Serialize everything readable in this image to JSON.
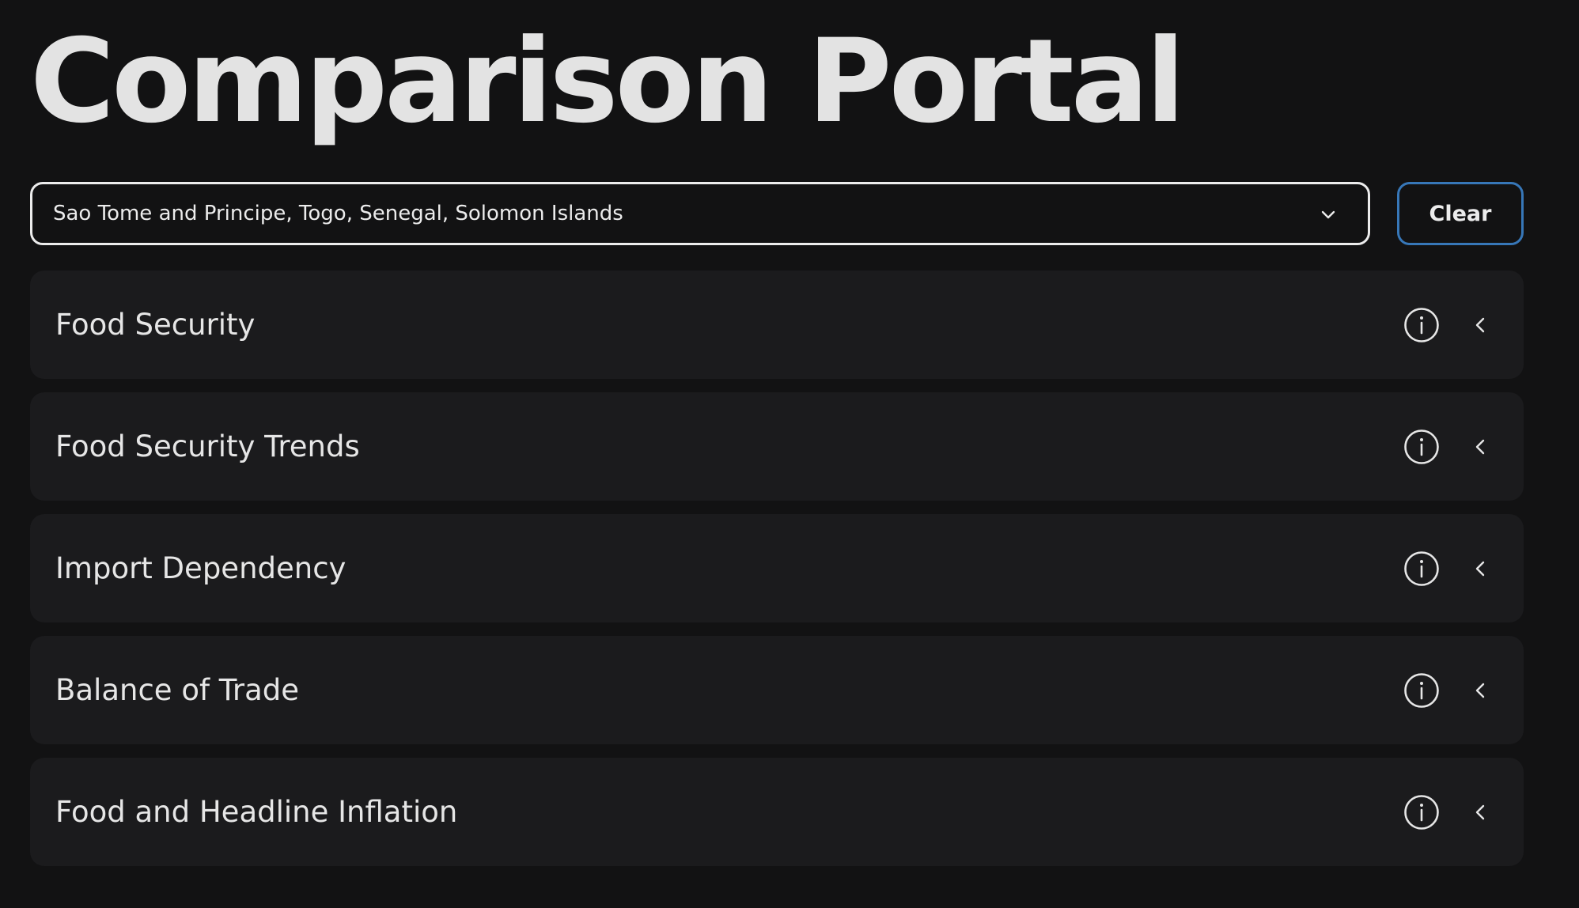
{
  "header": {
    "title": "Comparison Portal"
  },
  "country_select": {
    "value": "Sao Tome and Principe, Togo, Senegal, Solomon Islands",
    "icon": "chevron-down-icon"
  },
  "clear_button": {
    "label": "Clear"
  },
  "accordion": {
    "items": [
      {
        "label": "Food Security",
        "info_icon": "info-icon",
        "toggle_icon": "chevron-left-icon"
      },
      {
        "label": "Food Security Trends",
        "info_icon": "info-icon",
        "toggle_icon": "chevron-left-icon"
      },
      {
        "label": "Import Dependency",
        "info_icon": "info-icon",
        "toggle_icon": "chevron-left-icon"
      },
      {
        "label": "Balance of Trade",
        "info_icon": "info-icon",
        "toggle_icon": "chevron-left-icon"
      },
      {
        "label": "Food and Headline Inflation",
        "info_icon": "info-icon",
        "toggle_icon": "chevron-left-icon"
      }
    ]
  },
  "colors": {
    "background": "#121213",
    "card": "#1b1b1d",
    "text": "#e3e3e3",
    "select_border": "#ececec",
    "clear_border": "#3777b8"
  }
}
